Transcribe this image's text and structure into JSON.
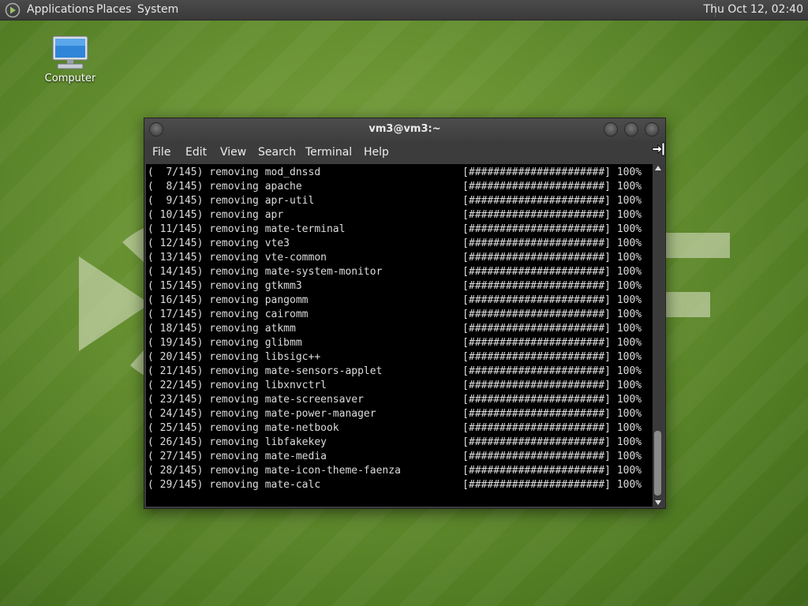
{
  "top_panel": {
    "menus": [
      "Applications",
      "Places",
      "System"
    ],
    "clock": "Thu Oct 12, 02:40"
  },
  "desktop": {
    "icons": [
      {
        "label": "Computer",
        "icon": "computer-icon"
      }
    ]
  },
  "terminal": {
    "title": "vm3@vm3:~",
    "menu": [
      "File",
      "Edit",
      "View",
      "Search",
      "Terminal",
      "Help"
    ],
    "lines": [
      "(  7/145) removing mod_dnssd                       [######################] 100%",
      "(  8/145) removing apache                          [######################] 100%",
      "(  9/145) removing apr-util                        [######################] 100%",
      "( 10/145) removing apr                             [######################] 100%",
      "( 11/145) removing mate-terminal                   [######################] 100%",
      "( 12/145) removing vte3                            [######################] 100%",
      "( 13/145) removing vte-common                      [######################] 100%",
      "( 14/145) removing mate-system-monitor             [######################] 100%",
      "( 15/145) removing gtkmm3                          [######################] 100%",
      "( 16/145) removing pangomm                         [######################] 100%",
      "( 17/145) removing cairomm                         [######################] 100%",
      "( 18/145) removing atkmm                           [######################] 100%",
      "( 19/145) removing glibmm                          [######################] 100%",
      "( 20/145) removing libsigc++                       [######################] 100%",
      "( 21/145) removing mate-sensors-applet             [######################] 100%",
      "( 22/145) removing libxnvctrl                      [######################] 100%",
      "( 23/145) removing mate-screensaver                [######################] 100%",
      "( 24/145) removing mate-power-manager              [######################] 100%",
      "( 25/145) removing mate-netbook                    [######################] 100%",
      "( 26/145) removing libfakekey                      [######################] 100%",
      "( 27/145) removing mate-media                      [######################] 100%",
      "( 28/145) removing mate-icon-theme-faenza          [######################] 100%",
      "( 29/145) removing mate-calc                       [######################] 100%"
    ]
  },
  "colors": {
    "desktop_green": "#6a9433",
    "panel": "#3a3a3a",
    "terminal_bg": "#000000",
    "terminal_fg": "#dcdcdc"
  }
}
